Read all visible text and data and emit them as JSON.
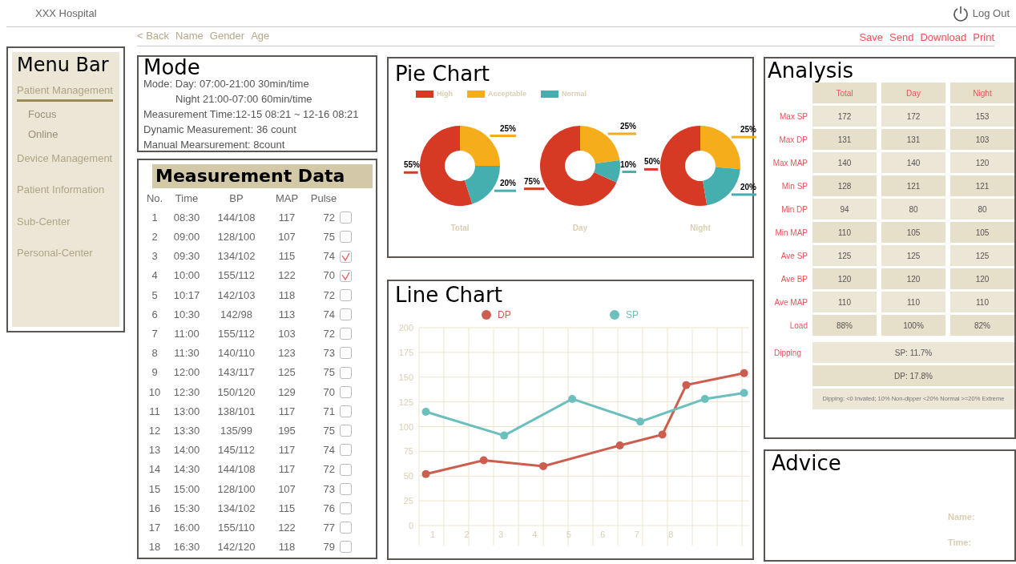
{
  "header": {
    "title": "XXX Hospital",
    "logout": "Log Out"
  },
  "subnav": {
    "back": "< Back",
    "fields": [
      "Name",
      "Gender",
      "Age"
    ],
    "actions": [
      "Save",
      "Send",
      "Download",
      "Print"
    ]
  },
  "menu": {
    "title": "Menu Bar",
    "items": [
      {
        "label": "Patient Management",
        "selected": true,
        "children": [
          {
            "label": "Focus"
          },
          {
            "label": "Online"
          }
        ]
      },
      {
        "label": "Device Management",
        "selected": false
      },
      {
        "label": "Patient Information",
        "selected": false
      },
      {
        "label": "Sub-Center",
        "selected": false
      },
      {
        "label": "Personal-Center",
        "selected": false
      }
    ]
  },
  "mode": {
    "title": "Mode",
    "lines": [
      "Mode: Day:  07:00-21:00  30min/time",
      "Night  21:00-07:00  60min/time",
      "Measurement Time:12-15 08:21 ~ 12-16 08:21",
      "Dynamic Measurement: 36  count",
      "Manual Mearsurement:  8count"
    ]
  },
  "measurement": {
    "title": "Measurement Data",
    "columns": [
      "No.",
      "Time",
      "BP",
      "MAP",
      "Pulse"
    ],
    "rows": [
      {
        "no": "1",
        "time": "08:30",
        "bp": "144/108",
        "map": "117",
        "pulse": "72",
        "checked": false
      },
      {
        "no": "2",
        "time": "09:00",
        "bp": "128/100",
        "map": "107",
        "pulse": "75",
        "checked": false
      },
      {
        "no": "3",
        "time": "09:30",
        "bp": "134/102",
        "map": "115",
        "pulse": "74",
        "checked": true
      },
      {
        "no": "4",
        "time": "10:00",
        "bp": "155/112",
        "map": "122",
        "pulse": "70",
        "checked": true
      },
      {
        "no": "5",
        "time": "10:17",
        "bp": "142/103",
        "map": "118",
        "pulse": "72",
        "checked": false
      },
      {
        "no": "6",
        "time": "10:30",
        "bp": "142/98",
        "map": "113",
        "pulse": "74",
        "checked": false
      },
      {
        "no": "7",
        "time": "11:00",
        "bp": "155/112",
        "map": "103",
        "pulse": "72",
        "checked": false
      },
      {
        "no": "8",
        "time": "11:30",
        "bp": "140/110",
        "map": "123",
        "pulse": "73",
        "checked": false
      },
      {
        "no": "9",
        "time": "12:00",
        "bp": "143/117",
        "map": "125",
        "pulse": "75",
        "checked": false
      },
      {
        "no": "10",
        "time": "12:30",
        "bp": "150/120",
        "map": "129",
        "pulse": "70",
        "checked": false
      },
      {
        "no": "11",
        "time": "13:00",
        "bp": "138/101",
        "map": "117",
        "pulse": "71",
        "checked": false
      },
      {
        "no": "12",
        "time": "13:30",
        "bp": "135/99",
        "map": "195",
        "pulse": "75",
        "checked": false
      },
      {
        "no": "13",
        "time": "14:00",
        "bp": "145/112",
        "map": "117",
        "pulse": "74",
        "checked": false
      },
      {
        "no": "14",
        "time": "14:30",
        "bp": "144/108",
        "map": "117",
        "pulse": "72",
        "checked": false
      },
      {
        "no": "15",
        "time": "15:00",
        "bp": "128/100",
        "map": "107",
        "pulse": "73",
        "checked": false
      },
      {
        "no": "16",
        "time": "15:30",
        "bp": "134/102",
        "map": "115",
        "pulse": "76",
        "checked": false
      },
      {
        "no": "17",
        "time": "16:00",
        "bp": "155/110",
        "map": "122",
        "pulse": "77",
        "checked": false
      },
      {
        "no": "18",
        "time": "16:30",
        "bp": "142/120",
        "map": "118",
        "pulse": "79",
        "checked": false
      }
    ]
  },
  "pie_chart": {
    "title": "Pie Chart",
    "legend": [
      {
        "label": "High",
        "color": "#d63a25"
      },
      {
        "label": "Acceptable",
        "color": "#f6ad1b"
      },
      {
        "label": "Normal",
        "color": "#45aeae"
      }
    ],
    "charts": [
      {
        "chart_data": {
          "type": "donut",
          "title": "Total",
          "values": [
            55,
            25,
            20
          ],
          "value_labels": [
            "55%",
            "25%",
            "20%"
          ]
        }
      },
      {
        "chart_data": {
          "type": "donut",
          "title": "Day",
          "values": [
            75,
            25,
            10
          ],
          "value_labels": [
            "75%",
            "25%",
            "10%"
          ]
        }
      },
      {
        "chart_data": {
          "type": "donut",
          "title": "Night",
          "values": [
            50,
            25,
            20
          ],
          "value_labels": [
            "50%",
            "25%",
            "20%"
          ]
        }
      }
    ]
  },
  "line_chart": {
    "title": "Line Chart",
    "chart_data": {
      "type": "line",
      "grid": true,
      "legend": "top",
      "xlim": [
        0.6,
        10.3
      ],
      "xticks": [
        1,
        2,
        3,
        4,
        5,
        6,
        7,
        8
      ],
      "yticks": [
        0,
        25,
        50,
        75,
        100,
        125,
        150,
        175,
        200
      ],
      "ylim": [
        0,
        200
      ],
      "series": [
        {
          "name": "DP",
          "color": "#cc5e50",
          "marker": "circle",
          "x": [
            0.8,
            2.5,
            4.25,
            6.5,
            7.75,
            8.45,
            10.15
          ],
          "values": [
            52,
            66,
            60,
            81,
            92,
            142,
            154
          ]
        },
        {
          "name": "SP",
          "color": "#6bbfbd",
          "marker": "circle",
          "x": [
            0.8,
            3.1,
            5.1,
            7.1,
            9,
            10.15
          ],
          "values": [
            115,
            91,
            128,
            105,
            128,
            134
          ]
        }
      ]
    }
  },
  "analysis": {
    "title": "Analysis",
    "columns": [
      "Total",
      "Day",
      "Night"
    ],
    "rows": [
      {
        "label": "Max SP",
        "values": [
          "172",
          "172",
          "153"
        ]
      },
      {
        "label": "Max DP",
        "values": [
          "131",
          "131",
          "103"
        ]
      },
      {
        "label": "Max MAP",
        "values": [
          "140",
          "140",
          "120"
        ]
      },
      {
        "label": "Min SP",
        "values": [
          "128",
          "121",
          "121"
        ]
      },
      {
        "label": "Min DP",
        "values": [
          "94",
          "80",
          "80"
        ]
      },
      {
        "label": "Min MAP",
        "values": [
          "110",
          "105",
          "105"
        ]
      },
      {
        "label": "Ave SP",
        "values": [
          "125",
          "125",
          "125"
        ]
      },
      {
        "label": "Ave BP",
        "values": [
          "120",
          "120",
          "120"
        ]
      },
      {
        "label": "Ave MAP",
        "values": [
          "110",
          "110",
          "110"
        ]
      },
      {
        "label": "Load",
        "values": [
          "88%",
          "100%",
          "82%"
        ]
      }
    ],
    "dipping": {
      "label": "Dipping",
      "lines": [
        "SP:   11.7%",
        "DP:   17.8%"
      ],
      "note": "Dipping: <0 Invated; 10% Non-dipper <20% Normal >=20% Extreme"
    }
  },
  "advice": {
    "title": "Advice",
    "fields": [
      "Name:",
      "Time:"
    ]
  }
}
